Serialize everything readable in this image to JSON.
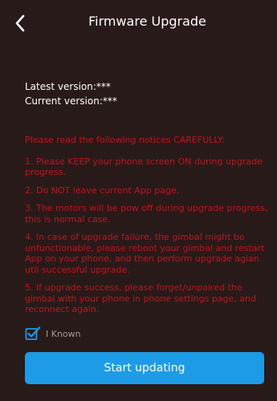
{
  "header": {
    "title": "Firmware Upgrade",
    "back_icon": "chevron-left-icon"
  },
  "versions": {
    "latest": "Latest version:***",
    "current": "Current version:***"
  },
  "notices": {
    "title": "Please read the following notices CAREFULLY:",
    "items": [
      "1. Please KEEP your phone screen ON during upgrade progress.",
      "2. Do NOT leave current App page.",
      "3. The motors will be pow off during upgrade progress, this is normal case.",
      "4. In case of upgrade failure, the gimbal might be unfunctionable,  please reboot your gimbal and restart App on your phone, and then perform upgrade agian util successful upgrade.",
      "5. If upgrade success, please forget/unpaired the gimbal with your phone in phone settings page, and reconnect again."
    ]
  },
  "acknowledge": {
    "label": "I Known",
    "checked": true,
    "icon": "checkbox-checked-icon"
  },
  "start_button": {
    "label": "Start updating"
  },
  "colors": {
    "background": "#281a19",
    "notice_red": "#c0141e",
    "accent_blue": "#1e9be6",
    "muted_text": "#a39b9a"
  }
}
